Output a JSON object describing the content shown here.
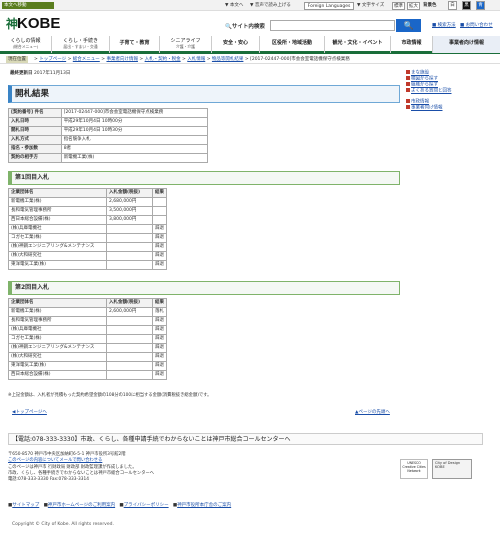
{
  "topbar": {
    "skip": "本文へ移動",
    "kana": "▼ 本文へ",
    "reader": "▼ 音声で読み上げる",
    "lang": "Foreign Languages",
    "size_label": "▼ 文字サイズ",
    "std": "標準",
    "big": "拡大",
    "bg": "背景色",
    "bg_opts": [
      "白",
      "黒",
      "青"
    ]
  },
  "header": {
    "logo_icon": "神",
    "logo_text": "KOBE",
    "search_label": "サイト内検索",
    "search_placeholder": "",
    "search_button": "🔍",
    "search_help": "■ 検索方法",
    "sitemap": "■ お問い合わせ"
  },
  "nav": [
    {
      "label": "くらしの情報",
      "sub": "(総合メニュー)"
    },
    {
      "label": "くらし・手続き",
      "sub": "届出・すまい・交通"
    },
    {
      "label": "子育て・教育",
      "sub": ""
    },
    {
      "label": "シニアライフ",
      "sub": "介護・介護"
    },
    {
      "label": "安全・安心",
      "sub": ""
    },
    {
      "label": "区役所・地域活動",
      "sub": ""
    },
    {
      "label": "観光・文化・イベント",
      "sub": ""
    },
    {
      "label": "市政情報",
      "sub": ""
    },
    {
      "label": "事業者向け情報",
      "sub": ""
    }
  ],
  "breadcrumb": {
    "here": "現在位置",
    "items": [
      "トップページ",
      "総合メニュー",
      "事業者向け情報",
      "入札・契約・税金",
      "入札情報",
      "物品等開札結果",
      "[2017-02447-000]市会会室電話機保守点検業務"
    ]
  },
  "updated": {
    "label": "最終更新日",
    "value": "2017年11月13日"
  },
  "title": "開札結果",
  "info": [
    {
      "k": "[契約番号] 件名",
      "v": "[2017-02447-000]市会会室電話機保守点検業務"
    },
    {
      "k": "入札日時",
      "v": "平成29年10月4日 10時00分"
    },
    {
      "k": "開札日時",
      "v": "平成29年10月4日 10時30分"
    },
    {
      "k": "入札方式",
      "v": "指名競争入札"
    },
    {
      "k": "指名・参加数",
      "v": "8者"
    },
    {
      "k": "契約の相手方",
      "v": "新電機工業(株)"
    }
  ],
  "round1": {
    "title": "第1回目入札",
    "headers": [
      "企業団体名",
      "入札金額(税抜)",
      "結果"
    ],
    "rows": [
      [
        "新電機工業(株)",
        "2,680,000円",
        ""
      ],
      [
        "長和電気管理事務所",
        "3,500,000円",
        ""
      ],
      [
        "西日本総合設備(株)",
        "3,800,000円",
        ""
      ],
      [
        "(株)兵庫電機社",
        "",
        "辞退"
      ],
      [
        "コガセ工業(株)",
        "",
        "辞退"
      ],
      [
        "(株)神鋼エンジニアリング&メンテナンス",
        "",
        "辞退"
      ],
      [
        "(株)大和研究社",
        "",
        "辞退"
      ],
      [
        "東洋電気工業(株)",
        "",
        "辞退"
      ]
    ]
  },
  "round2": {
    "title": "第2回目入札",
    "headers": [
      "企業団体名",
      "入札金額(税抜)",
      "結果"
    ],
    "rows": [
      [
        "新電機工業(株)",
        "2,600,000円",
        "落札"
      ],
      [
        "長和電気管理事務所",
        "",
        "辞退"
      ],
      [
        "(株)兵庫電機社",
        "",
        "辞退"
      ],
      [
        "コガセ工業(株)",
        "",
        "辞退"
      ],
      [
        "(株)神鋼エンジニアリング&メンテナンス",
        "",
        "辞退"
      ],
      [
        "(株)大和研究社",
        "",
        "辞退"
      ],
      [
        "東洋電気工業(株)",
        "",
        "辞退"
      ],
      [
        "西日本総合設備(株)",
        "",
        "辞退"
      ]
    ]
  },
  "note": "※上記金額は、入札者が見積もった契約希望金額の108分の100に相当する金額(消費税抜き総金額)です。",
  "pagelinks": {
    "top": "トップページへ",
    "up": "ページの先頭へ"
  },
  "side": {
    "items": [
      "まな施設",
      "検図から探す",
      "組織から探す",
      "よくある質問と回答"
    ],
    "items2": [
      "市政情報",
      "事業者向け情報"
    ]
  },
  "tour": {
    "prefix": "【電話:078-333-3330】",
    "text": "市政、くらし、各種申請手続でわからないことは神戸市総合コールセンターへ"
  },
  "footer": {
    "lines": [
      "〒650-8570 神戸市中央区加納町6-5-1 神戸市役所3号館2階",
      "このページの内容についてメールで問い合わせる",
      "このページは神戸市 行財政局 財政部 財政監理課が作成しました。",
      "市政、くらし、各種手続きでわからないことは神戸市総合コールセンターへ",
      "電話:078-333-3330 Fax:078-333-3314"
    ],
    "logo": "City of Design KOBE",
    "unesco": "UNESCO Creative Cities Network"
  },
  "footlinks": [
    "サイトマップ",
    "神戸市ホームページのご利用案内",
    "プライバシーポリシー",
    "神戸市役所本庁舎のご案内"
  ],
  "copyright": "Copyright © City of Kobe. All rights reserved."
}
